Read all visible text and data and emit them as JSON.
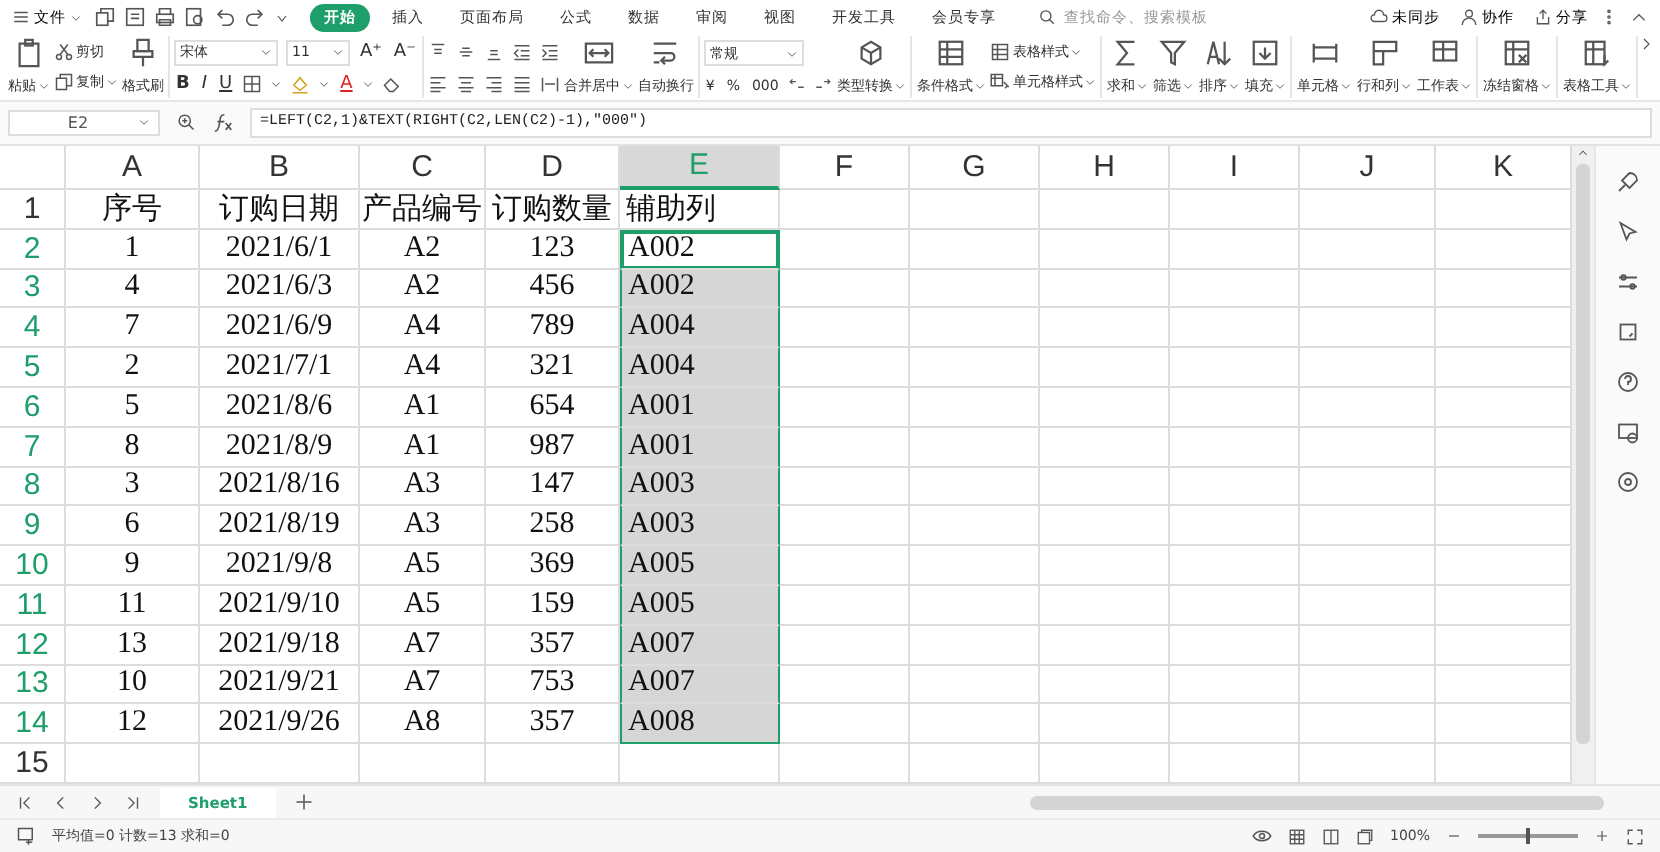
{
  "menu": {
    "file": "文件",
    "tabs": [
      {
        "label": "开始",
        "selected": true
      },
      {
        "label": "插入",
        "selected": false
      },
      {
        "label": "页面布局",
        "selected": false
      },
      {
        "label": "公式",
        "selected": false
      },
      {
        "label": "数据",
        "selected": false
      },
      {
        "label": "审阅",
        "selected": false
      },
      {
        "label": "视图",
        "selected": false
      },
      {
        "label": "开发工具",
        "selected": false
      },
      {
        "label": "会员专享",
        "selected": false
      }
    ],
    "search": {
      "placeholder": "查找命令、搜索模板"
    },
    "actions": [
      "未同步",
      "协作",
      "分享"
    ]
  },
  "ribbon": {
    "groups": [
      {
        "items": [
          {
            "kind": "large",
            "label": "粘贴",
            "dropdown": true
          },
          {
            "kind": "stack",
            "items": [
              {
                "label": "剪切",
                "dropdown": false
              },
              {
                "label": "复制",
                "dropdown": true
              }
            ]
          },
          {
            "kind": "large",
            "label": "格式刷",
            "dropdown": false
          }
        ]
      },
      {
        "items": [
          {
            "kind": "font",
            "font": "宋体",
            "size": "11",
            "size_buttons": [
              "A⁺",
              "A⁻"
            ],
            "styles": [
              "B",
              "I",
              "U"
            ],
            "color_glyph": "A"
          }
        ]
      },
      {
        "items": [
          {
            "kind": "align"
          },
          {
            "kind": "large",
            "label": "合并居中",
            "dropdown": true
          },
          {
            "kind": "large",
            "label": "自动换行",
            "dropdown": false
          }
        ]
      },
      {
        "items": [
          {
            "kind": "number",
            "format": "常规",
            "symbols": [
              "¥",
              "%",
              "000"
            ]
          },
          {
            "kind": "large",
            "label": "类型转换",
            "dropdown": true
          }
        ]
      },
      {
        "items": [
          {
            "kind": "large",
            "label": "条件格式",
            "dropdown": true
          },
          {
            "kind": "stack",
            "items": [
              {
                "label": "表格样式",
                "dropdown": true
              },
              {
                "label": "单元格样式",
                "dropdown": true
              }
            ]
          }
        ]
      },
      {
        "items": [
          {
            "kind": "large",
            "label": "求和",
            "dropdown": true
          },
          {
            "kind": "large",
            "label": "筛选",
            "dropdown": true
          },
          {
            "kind": "large",
            "label": "排序",
            "dropdown": true
          },
          {
            "kind": "large",
            "label": "填充",
            "dropdown": true
          }
        ]
      },
      {
        "items": [
          {
            "kind": "large",
            "label": "单元格",
            "dropdown": true
          },
          {
            "kind": "large",
            "label": "行和列",
            "dropdown": true
          },
          {
            "kind": "large",
            "label": "工作表",
            "dropdown": true
          }
        ]
      },
      {
        "items": [
          {
            "kind": "large",
            "label": "冻结窗格",
            "dropdown": true
          }
        ]
      },
      {
        "items": [
          {
            "kind": "large",
            "label": "表格工具",
            "dropdown": true
          }
        ]
      }
    ]
  },
  "formula_bar": {
    "name_box": "E2",
    "formula": "=LEFT(C2,1)&TEXT(RIGHT(C2,LEN(C2)-1),\"000\")"
  },
  "grid": {
    "columns": [
      {
        "label": "A",
        "selected": false
      },
      {
        "label": "B",
        "selected": false
      },
      {
        "label": "C",
        "selected": false
      },
      {
        "label": "D",
        "selected": false
      },
      {
        "label": "E",
        "selected": true
      },
      {
        "label": "F",
        "selected": false
      },
      {
        "label": "G",
        "selected": false
      },
      {
        "label": "H",
        "selected": false
      },
      {
        "label": "I",
        "selected": false
      },
      {
        "label": "J",
        "selected": false
      },
      {
        "label": "K",
        "selected": false
      }
    ],
    "rows": [
      {
        "number": "1",
        "selected": false,
        "active": false,
        "cells": [
          "序号",
          "订购日期",
          "产品编号",
          "订购数量",
          "辅助列"
        ]
      },
      {
        "number": "2",
        "selected": true,
        "active": true,
        "cells": [
          "1",
          "2021/6/1",
          "A2",
          "123",
          "A002"
        ]
      },
      {
        "number": "3",
        "selected": true,
        "active": false,
        "cells": [
          "4",
          "2021/6/3",
          "A2",
          "456",
          "A002"
        ]
      },
      {
        "number": "4",
        "selected": true,
        "active": false,
        "cells": [
          "7",
          "2021/6/9",
          "A4",
          "789",
          "A004"
        ]
      },
      {
        "number": "5",
        "selected": true,
        "active": false,
        "cells": [
          "2",
          "2021/7/1",
          "A4",
          "321",
          "A004"
        ]
      },
      {
        "number": "6",
        "selected": true,
        "active": false,
        "cells": [
          "5",
          "2021/8/6",
          "A1",
          "654",
          "A001"
        ]
      },
      {
        "number": "7",
        "selected": true,
        "active": false,
        "cells": [
          "8",
          "2021/8/9",
          "A1",
          "987",
          "A001"
        ]
      },
      {
        "number": "8",
        "selected": true,
        "active": false,
        "cells": [
          "3",
          "2021/8/16",
          "A3",
          "147",
          "A003"
        ]
      },
      {
        "number": "9",
        "selected": true,
        "active": false,
        "cells": [
          "6",
          "2021/8/19",
          "A3",
          "258",
          "A003"
        ]
      },
      {
        "number": "10",
        "selected": true,
        "active": false,
        "cells": [
          "9",
          "2021/9/8",
          "A5",
          "369",
          "A005"
        ]
      },
      {
        "number": "11",
        "selected": true,
        "active": false,
        "cells": [
          "11",
          "2021/9/10",
          "A5",
          "159",
          "A005"
        ]
      },
      {
        "number": "12",
        "selected": true,
        "active": false,
        "cells": [
          "13",
          "2021/9/18",
          "A7",
          "357",
          "A007"
        ]
      },
      {
        "number": "13",
        "selected": true,
        "active": false,
        "cells": [
          "10",
          "2021/9/21",
          "A7",
          "753",
          "A007"
        ]
      },
      {
        "number": "14",
        "selected": true,
        "active": false,
        "cells": [
          "12",
          "2021/9/26",
          "A8",
          "357",
          "A008"
        ]
      },
      {
        "number": "15",
        "selected": false,
        "active": false,
        "cells": []
      }
    ]
  },
  "sheets": [
    {
      "label": "Sheet1",
      "selected": true
    }
  ],
  "status_bar": {
    "summary": "平均值=0 计数=13 求和=0",
    "zoom": "100%",
    "zoom_slider": {
      "level": 0.5
    }
  }
}
